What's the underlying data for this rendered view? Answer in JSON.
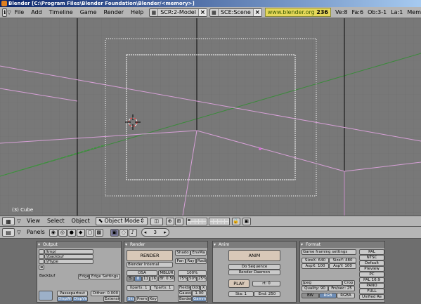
{
  "window": {
    "title": "Blender [C:\\Program Files\\Blender Foundation\\Blender/<memory>]"
  },
  "info_header": {
    "menus": [
      "File",
      "Add",
      "Timeline",
      "Game",
      "Render",
      "Help"
    ],
    "screen_field": "SCR:2-Model",
    "scene_field": "SCE:Scene",
    "link_text": "www.blender.org",
    "version": "236",
    "stats": [
      "Ve:8",
      "Fa:6",
      "Ob:3-1",
      "La:1",
      "Mem"
    ]
  },
  "viewport": {
    "object_label": "(3) Cube"
  },
  "view3d_header": {
    "menus": [
      "View",
      "Select",
      "Object"
    ],
    "mode": "Object Mode"
  },
  "buttons_header": {
    "panels_label": "Panels",
    "frame_value": "3"
  },
  "panels": {
    "output": {
      "title": "Output",
      "paths": [
        "/tmp/",
        "//backbuf",
        "//ftype"
      ],
      "backbuf": "Backbuf",
      "edge": "Edge",
      "edge_settings": "Edge Settings",
      "passepartout": "Passepartout",
      "dither": "Dither: 0.000",
      "dispwin": "DispWin",
      "dispview": "DispView",
      "extensions": "Extensio"
    },
    "render": {
      "title": "Render",
      "render_btn": "RENDER",
      "engine": "Blender Internal",
      "shadow": "Shado",
      "envmap": "EnvMa",
      "pano": "Pan",
      "ray": "Ray",
      "radio": "Radi",
      "osa": "OSA",
      "mblur": "MBLUR",
      "osa_levels": [
        "5",
        "8",
        "11",
        "16"
      ],
      "bf": "Bf: 0.50",
      "size_pct": "100%",
      "size_opts": [
        "75%",
        "50%",
        "25%"
      ],
      "xparts": "Xparts: 1",
      "yparts": "Yparts: 1",
      "fields": "Fields",
      "odd": "Odd",
      "x": "X",
      "gauss": "Gauss",
      "gauss_val": "1.00",
      "sky": "Sky",
      "premul": "Prem",
      "key": "Key",
      "border": "Border",
      "gamma": "Gamma"
    },
    "anim": {
      "title": "Anim",
      "anim_btn": "ANIM",
      "do_sequence": "Do Sequence",
      "render_daemon": "Render Daemon",
      "play": "PLAY",
      "rt": "rt: 0",
      "sta": "Sta: 1",
      "end": "End: 250"
    },
    "format": {
      "title": "Format",
      "preset": "Game framing settings",
      "sizex": "SizeX: 640",
      "sizey": "SizeY: 480",
      "aspx": "AspX: 100",
      "aspy": "AspY: 100",
      "filetype": "Jpeg",
      "crop": "Crop",
      "quality": "Quality: 90",
      "frs_sec": "Frs/sec: 25",
      "bw": "BW",
      "rgb": "RGB",
      "rgba": "RGBA",
      "presets": [
        "PAL",
        "NTSC",
        "Default",
        "Preview",
        "PC",
        "PAL 16:9",
        "PANO",
        "FULL",
        "Unified Re"
      ]
    }
  }
}
